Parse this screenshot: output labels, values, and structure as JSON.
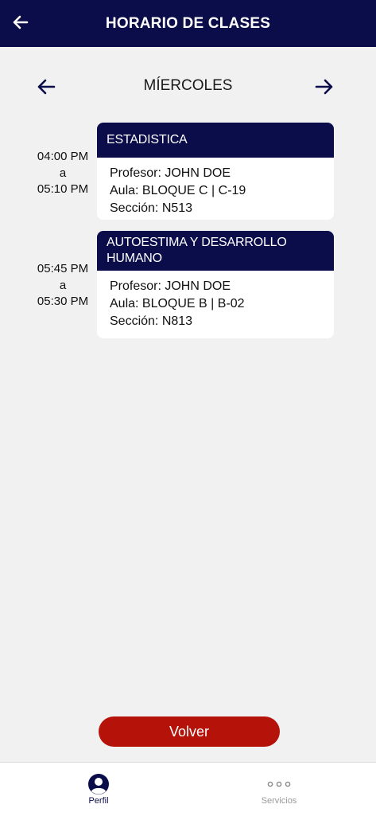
{
  "header": {
    "title": "HORARIO DE CLASES"
  },
  "day_nav": {
    "label": "MÍERCOLES"
  },
  "classes": [
    {
      "subject": "ESTADISTICA",
      "start": "04:00 PM",
      "separator": "a",
      "end": "05:10 PM",
      "profesor": "Profesor: JOHN DOE",
      "aula": "Aula: BLOQUE C | C-19",
      "seccion": "Sección: N513"
    },
    {
      "subject": "AUTOESTIMA Y DESARROLLO HUMANO",
      "start": "05:45 PM",
      "separator": "a",
      "end": "05:30 PM",
      "profesor": "Profesor: JOHN DOE",
      "aula": "Aula: BLOQUE B | B-02",
      "seccion": "Sección: N813"
    }
  ],
  "actions": {
    "volver_label": "Volver"
  },
  "tabbar": {
    "items": [
      {
        "label": "Perfil",
        "icon": "profile-icon",
        "active": true
      },
      {
        "label": "Servicios",
        "icon": "more-dots-icon",
        "active": false
      }
    ]
  },
  "colors": {
    "primary": "#0b0c4a",
    "danger": "#b5120a",
    "background": "#f1f1f1"
  }
}
